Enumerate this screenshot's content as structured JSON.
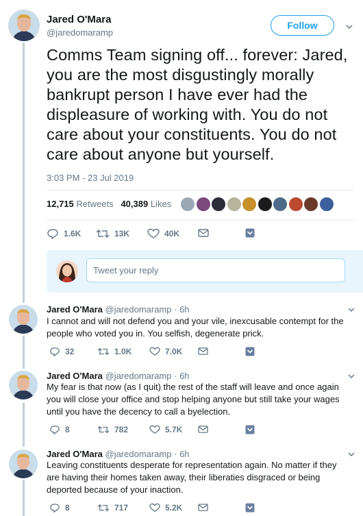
{
  "colors": {
    "accent": "#1da1f2",
    "muted": "#657786",
    "text": "#14171a",
    "reply_bg": "#e8f5fd",
    "dm_icon": "#6b7fa1"
  },
  "main_tweet": {
    "author_name": "Jared O'Mara",
    "author_handle": "@jaredomaramp",
    "follow_label": "Follow",
    "text": "Comms Team signing off... forever: Jared, you are the most disgustingly morally bankrupt person I have ever had the displeasure of working with. You do not care about your constituents. You do not care about anyone but yourself.",
    "timestamp": "3:03 PM - 23 Jul 2019",
    "retweets_count": "12,715",
    "retweets_label": "Retweets",
    "likes_count": "40,389",
    "likes_label": "Likes",
    "liker_avatar_colors": [
      "#9aa8b4",
      "#7a4a7c",
      "#2d2d3a",
      "#b6b49a",
      "#c7902a",
      "#1b1b1b",
      "#4f6b8a",
      "#bb4a2e",
      "#6a3b2a",
      "#3e5f9e"
    ],
    "actions": {
      "replies": "1.6K",
      "retweets": "13K",
      "likes": "40K"
    }
  },
  "reply_box": {
    "placeholder": "Tweet your reply"
  },
  "replies": [
    {
      "author_name": "Jared O'Mara",
      "author_handle": "@jaredomaramp",
      "time": "· 6h",
      "text": "I cannot and will not defend you and your vile, inexcusable contempt for the people who voted you in. You selfish, degenerate prick.",
      "replies": "32",
      "retweets": "1.0K",
      "likes": "7.0K"
    },
    {
      "author_name": "Jared O'Mara",
      "author_handle": "@jaredomaramp",
      "time": "· 6h",
      "text": "My fear is that now (as I quit) the rest of the staff will leave and once again you will close your office and stop helping anyone but still take your wages until you have the decency to call a byelection.",
      "replies": "8",
      "retweets": "782",
      "likes": "5.7K"
    },
    {
      "author_name": "Jared O'Mara",
      "author_handle": "@jaredomaramp",
      "time": "· 6h",
      "text": "Leaving constituents desperate for representation again. No matter if they are having their homes taken away, their liberaties disgraced or being deported because of your inaction.",
      "replies": "8",
      "retweets": "717",
      "likes": "5.2K"
    }
  ]
}
